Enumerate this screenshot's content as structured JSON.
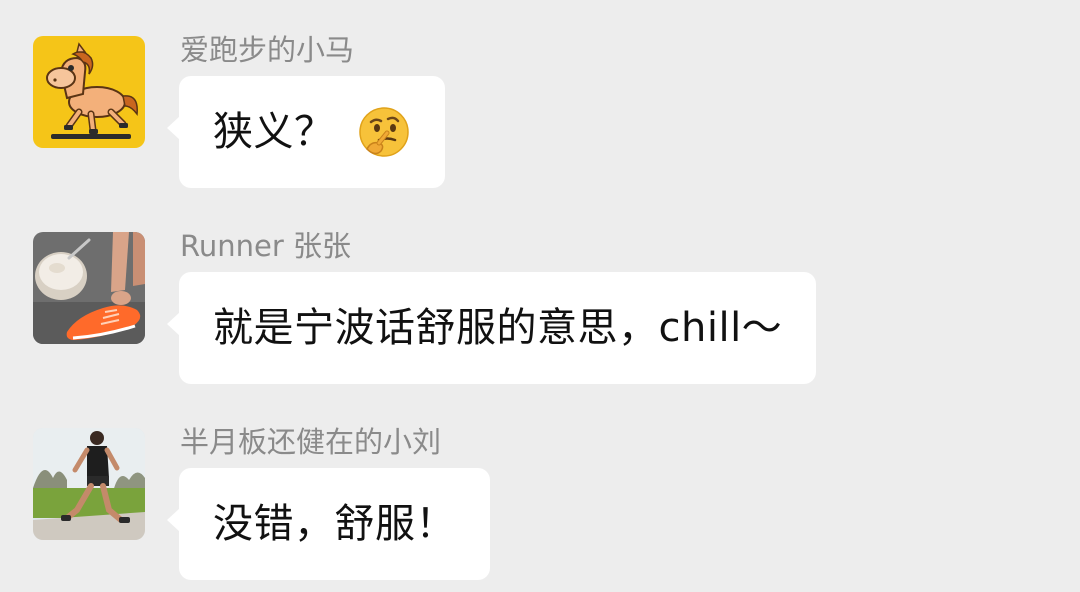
{
  "messages": [
    {
      "sender": "爱跑步的小马",
      "text": "狭义？",
      "emoji": "thinking-face-icon",
      "avatar": "pony-avatar"
    },
    {
      "sender": "Runner 张张",
      "text": "就是宁波话舒服的意思，chill～",
      "avatar": "shoe-lacing-avatar"
    },
    {
      "sender": "半月板还健在的小刘",
      "text": "没错，舒服！",
      "avatar": "runner-in-park-avatar"
    }
  ],
  "colors": {
    "background": "#ededed",
    "bubble": "#ffffff",
    "sender_name": "#8a8a8a",
    "message_text": "#111111",
    "pony_avatar_bg": "#f5c518"
  }
}
